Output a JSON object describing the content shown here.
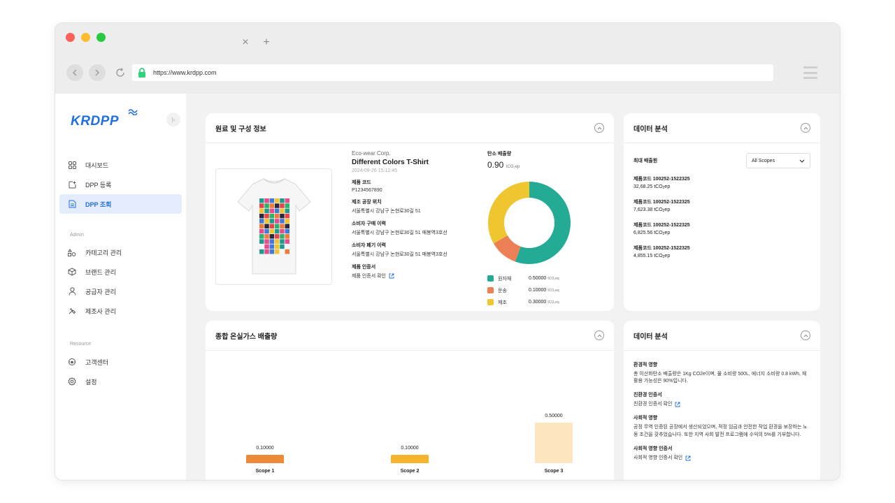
{
  "browser": {
    "tab_close": "×",
    "tab_new": "+",
    "url": "https://www.krdpp.com"
  },
  "sidebar": {
    "logo": "KRDPP",
    "collapse": "|‹",
    "main_items": [
      {
        "label": "대시보드",
        "icon": "grid-icon"
      },
      {
        "label": "DPP 등록",
        "icon": "add-document-icon"
      },
      {
        "label": "DPP 조회",
        "icon": "document-search-icon",
        "active": true
      }
    ],
    "admin_label": "Admin",
    "admin_items": [
      {
        "label": "카테고리 관리",
        "icon": "category-icon"
      },
      {
        "label": "브랜드 관리",
        "icon": "box-icon"
      },
      {
        "label": "공급자 관리",
        "icon": "user-icon"
      },
      {
        "label": "제조사 관리",
        "icon": "tools-icon"
      }
    ],
    "resource_label": "Resource",
    "resource_items": [
      {
        "label": "고객센터",
        "icon": "headset-icon"
      },
      {
        "label": "설정",
        "icon": "gear-icon"
      }
    ]
  },
  "composition": {
    "title": "원료 및 구성 정보",
    "brand": "Eco-wear Corp.",
    "product_name": "Different Colors T-Shirt",
    "date": "2024-09-26 15:12:45",
    "fields": [
      {
        "label": "제품 코드",
        "value": "P1234567890"
      },
      {
        "label": "제조 공장 위치",
        "value": "서울특별시 강남구 논현로30길 51"
      },
      {
        "label": "소비자 구매 이력",
        "value": "서울특별시 강남구 논현로30길 51 매봉역3호선"
      },
      {
        "label": "소비자 폐기 이력",
        "value": "서울특별시 강남구 논현로30길 51 매봉역3호선"
      },
      {
        "label": "제품 인증서",
        "value": "제품 인증서 확인",
        "link": true
      }
    ],
    "carbon_label": "탄소 배출량",
    "carbon_value": "0.90",
    "carbon_unit": "tCO₂ep"
  },
  "chart_data": [
    {
      "type": "pie",
      "title": "탄소 배출량",
      "categories": [
        "원자재",
        "운송",
        "제조"
      ],
      "values": [
        0.5,
        0.1,
        0.3
      ],
      "value_labels": [
        "0.50000",
        "0.10000",
        "0.30000"
      ],
      "unit": "tCO₂eq",
      "colors": [
        "#23ab95",
        "#ec7f55",
        "#f0c630"
      ]
    },
    {
      "type": "bar",
      "title": "종합 온실가스 배출량",
      "categories": [
        "Scope 1",
        "Scope 2",
        "Scope 3"
      ],
      "values": [
        0.1,
        0.1,
        0.5
      ],
      "value_labels": [
        "0.10000",
        "0.10000",
        "0.50000"
      ],
      "colors": [
        "#ec8a3a",
        "#f6b32e",
        "#fde6bd"
      ],
      "ylim": [
        0,
        0.5
      ]
    }
  ],
  "ghg": {
    "title": "종합 온실가스 배출량"
  },
  "analysis_top": {
    "title": "데이터 분석",
    "label": "최대 배출원",
    "select_value": "All Scopes",
    "items": [
      {
        "code": "제품코드 100252-1522325",
        "value": "32,68.25 tCO",
        "sub": "2",
        "suffix": "ep"
      },
      {
        "code": "제품코드 100252-1522325",
        "value": "7,623.38 tCO",
        "sub": "2",
        "suffix": "ep"
      },
      {
        "code": "제품코드 100252-1522325",
        "value": "6,825.56 tCO",
        "sub": "2",
        "suffix": "ep"
      },
      {
        "code": "제품코드 100252-1522325",
        "value": "4,855.15 tCO",
        "sub": "2",
        "suffix": "ep"
      }
    ]
  },
  "analysis_bottom": {
    "title": "데이터 분석",
    "blocks": [
      {
        "title": "환경적 영향",
        "text": "총 이산화탄소 배출량은 1Kg CO2e이며, 물 소비량 500L, 에너지 소비량 0.8 kWh, 재활용 가능성은 90%입니다."
      },
      {
        "title": "친환경 인증서",
        "text": "친환경 인증서 확인",
        "link": true
      },
      {
        "title": "사회적 영향",
        "text": "공정 무역 인증된 공장에서 생산되었으며, 적정 임금과 안전한 작업 환경을 보장하는 노동 조건을 갖추었습니다. 또한 지역 사회 발전 프로그램에 수익의 5%를 기부합니다."
      },
      {
        "title": "사회적 영향 인증서",
        "text": "사회적 영향 인증서 확인",
        "link": true
      }
    ]
  }
}
